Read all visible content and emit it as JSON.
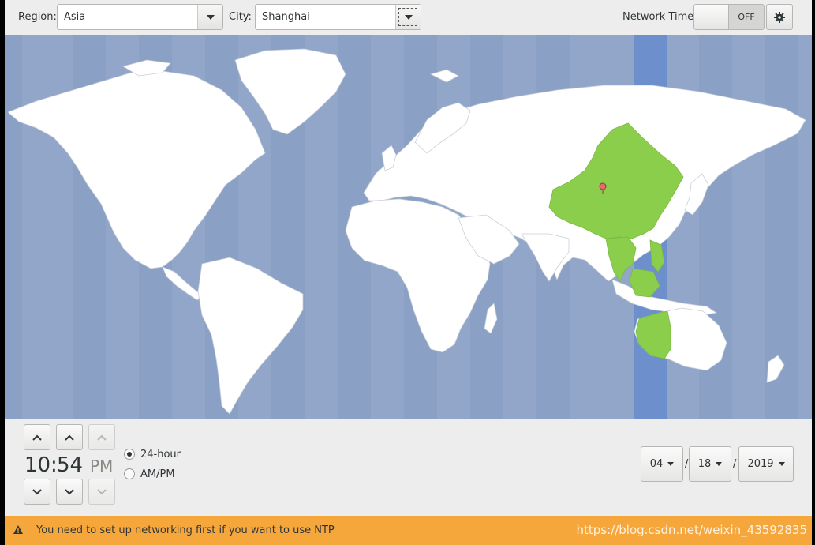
{
  "topbar": {
    "region_label": "Region:",
    "region_value": "Asia",
    "city_label": "City:",
    "city_value": "Shanghai",
    "network_time_label": "Network Time",
    "network_time_state": "OFF"
  },
  "map": {
    "selected_city": "Shanghai",
    "colors": {
      "ocean": "#91a6c8",
      "land": "#ffffff",
      "selected_zone_land": "#8bce4c",
      "selected_zone_band": "#6d8fcb",
      "marker": "#e86b6b"
    }
  },
  "time": {
    "hours": "10",
    "separator": ":",
    "minutes": "54",
    "period": "PM"
  },
  "format": {
    "option_24h": "24-hour",
    "option_ampm": "AM/PM",
    "selected": "24-hour"
  },
  "date": {
    "month": "04",
    "day": "18",
    "year": "2019",
    "separator": "/"
  },
  "warning": {
    "message": "You need to set up networking first if you want to use NTP",
    "watermark": "https://blog.csdn.net/weixin_43592835"
  }
}
